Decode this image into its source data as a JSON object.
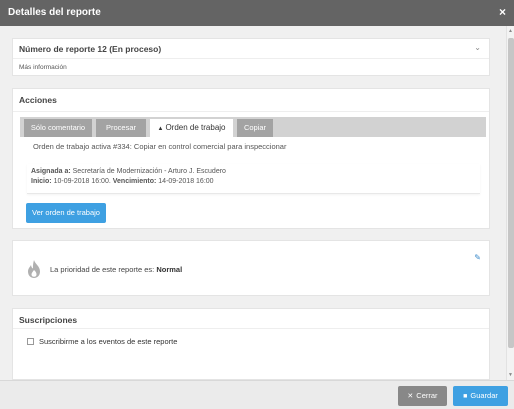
{
  "window": {
    "title": "Detalles del reporte",
    "close_glyph": "×"
  },
  "report": {
    "heading": "Número de reporte 12 (En proceso)",
    "more_info": "Más información"
  },
  "actions": {
    "heading": "Acciones",
    "tabs": [
      {
        "label": "Sólo comentario"
      },
      {
        "label": "Procesar"
      },
      {
        "label": "Orden de trabajo",
        "icon": "warning-triangle-icon"
      },
      {
        "label": "Copiar"
      }
    ],
    "active_tab": "Orden de trabajo",
    "active_work_order": "Orden de trabajo activa #334: Copiar en control comercial para inspeccionar",
    "assigned_label": "Asignada a:",
    "assigned_value": "Secretaría de Modernización - Arturo J. Escudero",
    "start_label": "Inicio:",
    "start_value": "10-09-2018 16:00.",
    "due_label": "Vencimiento:",
    "due_value": "14-09-2018 16:00",
    "view_button": "Ver orden de trabajo"
  },
  "priority": {
    "text": "La prioridad de este reporte es:",
    "value": "Normal",
    "icon": "flame-icon",
    "edit_icon": "pencil-icon",
    "icon_color": "#b0b0b0"
  },
  "subscriptions": {
    "heading": "Suscripciones",
    "checkbox_label": "Suscribirme a los eventos de este reporte",
    "checked": false
  },
  "footer": {
    "close_label": "Cerrar",
    "save_label": "Guardar"
  },
  "colors": {
    "titlebar": "#646464",
    "primary": "#3ea0e2",
    "tab_inactive": "#a3a3a3",
    "button_close": "#888888"
  }
}
